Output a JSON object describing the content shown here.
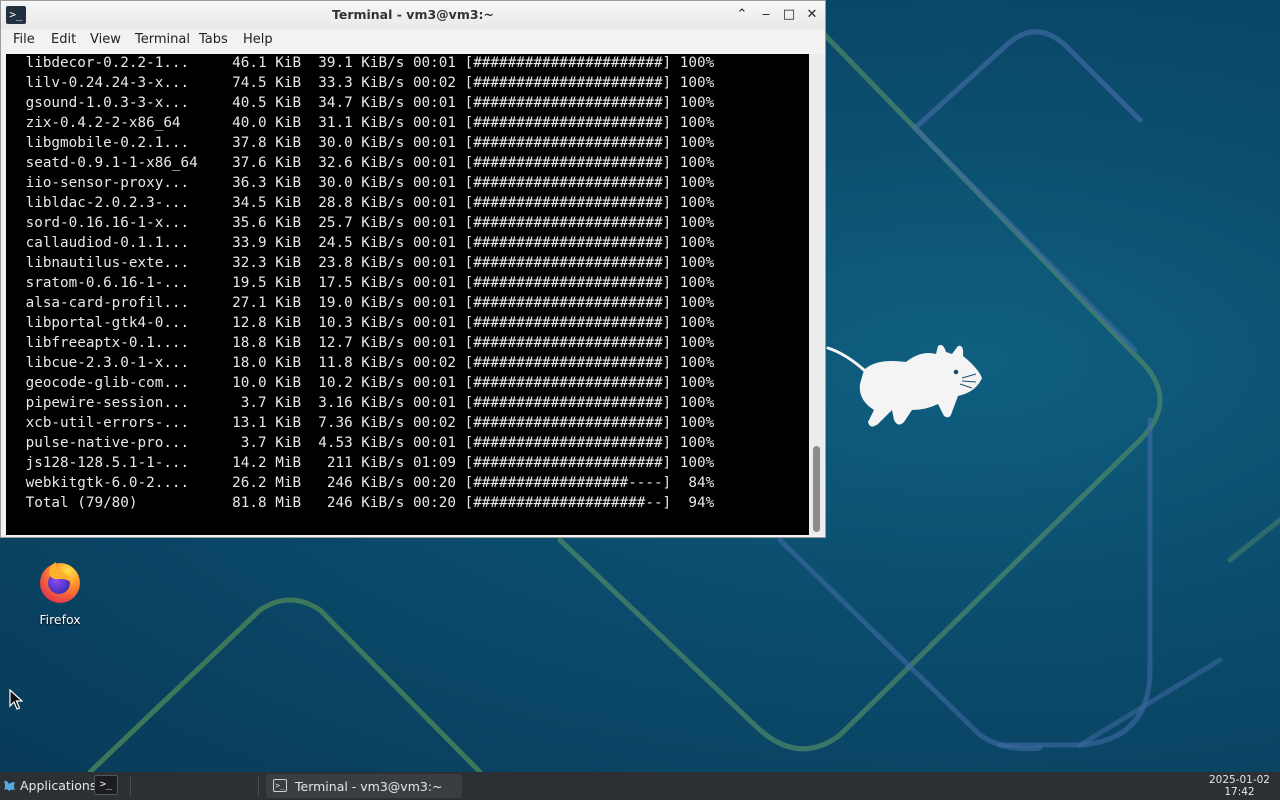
{
  "window": {
    "title": "Terminal - vm3@vm3:~",
    "app_icon_glyph": ">_",
    "controls": {
      "minimize_glyph": "‒",
      "maximize_glyph": "□",
      "close_glyph": "✕",
      "shade_glyph": "⌃"
    },
    "menu": [
      "File",
      "Edit",
      "View",
      "Terminal",
      "Tabs",
      "Help"
    ]
  },
  "terminal": {
    "lines": [
      " libdecor-0.2.2-1...     46.1 KiB  39.1 KiB/s 00:01 [######################] 100%",
      " lilv-0.24.24-3-x...     74.5 KiB  33.3 KiB/s 00:02 [######################] 100%",
      " gsound-1.0.3-3-x...     40.5 KiB  34.7 KiB/s 00:01 [######################] 100%",
      " zix-0.4.2-2-x86_64      40.0 KiB  31.1 KiB/s 00:01 [######################] 100%",
      " libgmobile-0.2.1...     37.8 KiB  30.0 KiB/s 00:01 [######################] 100%",
      " seatd-0.9.1-1-x86_64    37.6 KiB  32.6 KiB/s 00:01 [######################] 100%",
      " iio-sensor-proxy...     36.3 KiB  30.0 KiB/s 00:01 [######################] 100%",
      " libldac-2.0.2.3-...     34.5 KiB  28.8 KiB/s 00:01 [######################] 100%",
      " sord-0.16.16-1-x...     35.6 KiB  25.7 KiB/s 00:01 [######################] 100%",
      " callaudiod-0.1.1...     33.9 KiB  24.5 KiB/s 00:01 [######################] 100%",
      " libnautilus-exte...     32.3 KiB  23.8 KiB/s 00:01 [######################] 100%",
      " sratom-0.6.16-1-...     19.5 KiB  17.5 KiB/s 00:01 [######################] 100%",
      " alsa-card-profil...     27.1 KiB  19.0 KiB/s 00:01 [######################] 100%",
      " libportal-gtk4-0...     12.8 KiB  10.3 KiB/s 00:01 [######################] 100%",
      " libfreeaptx-0.1....     18.8 KiB  12.7 KiB/s 00:01 [######################] 100%",
      " libcue-2.3.0-1-x...     18.0 KiB  11.8 KiB/s 00:02 [######################] 100%",
      " geocode-glib-com...     10.0 KiB  10.2 KiB/s 00:01 [######################] 100%",
      " pipewire-session...      3.7 KiB  3.16 KiB/s 00:01 [######################] 100%",
      " xcb-util-errors-...     13.1 KiB  7.36 KiB/s 00:02 [######################] 100%",
      " pulse-native-pro...      3.7 KiB  4.53 KiB/s 00:01 [######################] 100%",
      " js128-128.5.1-1-...     14.2 MiB   211 KiB/s 01:09 [######################] 100%",
      " webkitgtk-6.0-2....     26.2 MiB   246 KiB/s 00:20 [##################----]  84%",
      " Total (79/80)           81.8 MiB   246 KiB/s 00:20 [####################--]  94%"
    ],
    "scroll_position": 0.95
  },
  "desktop": {
    "icons": [
      {
        "label": "Firefox",
        "icon": "firefox-icon"
      }
    ],
    "background_colors": {
      "base": "#0b4b6c",
      "line_green": "#4e8a66",
      "line_blue": "#3f6aa3"
    }
  },
  "taskbar": {
    "applications_label": "Applications",
    "launcher_glyph": ">_",
    "task_label": "Terminal - vm3@vm3:~",
    "task_icon_glyph": ">_",
    "clock_date": "2025-01-02",
    "clock_time": "17:42"
  }
}
